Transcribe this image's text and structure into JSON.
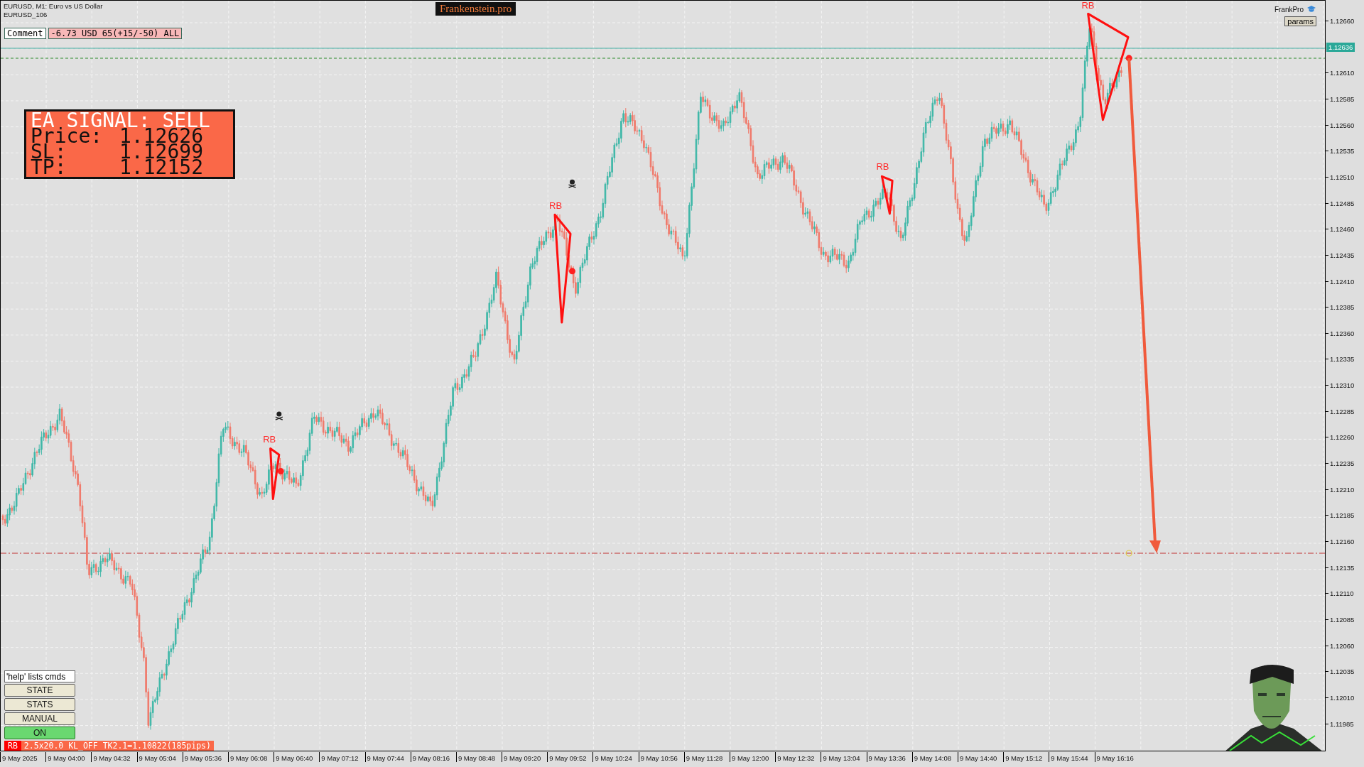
{
  "header": {
    "symbol_line": "EURUSD, M1:  Euro vs US Dollar",
    "subtitle": "EURUSD_106",
    "brand": "Frankenstein.pro",
    "account": "FrankPro",
    "params_button": "params"
  },
  "comment": {
    "label": "Comment",
    "value": "-6.73 USD 65(+15/-50) ALL"
  },
  "signal": {
    "title": "EA SIGNAL: SELL",
    "rows": [
      {
        "label": "Price:",
        "value": "1.12626"
      },
      {
        "label": "SL:",
        "value": "1.12699"
      },
      {
        "label": "TP:",
        "value": "1.12152"
      }
    ]
  },
  "patterns": [
    {
      "label": "RB"
    },
    {
      "label": "RB"
    },
    {
      "label": "RB"
    },
    {
      "label": "RB"
    }
  ],
  "controls": {
    "command_field": {
      "value": "'help' lists cmds"
    },
    "buttons": [
      {
        "label": "STATE",
        "on": false
      },
      {
        "label": "STATS",
        "on": false
      },
      {
        "label": "MANUAL",
        "on": false
      },
      {
        "label": "ON",
        "on": true
      }
    ]
  },
  "status_line": {
    "tag": "RB",
    "text": "2.5x20.0 KL_OFF TK2.1=1.10822(185pips)"
  },
  "price_axis": {
    "current_price": "1.12636",
    "ticks": [
      "1.12660",
      "1.12610",
      "1.12585",
      "1.12560",
      "1.12535",
      "1.12510",
      "1.12485",
      "1.12460",
      "1.12435",
      "1.12410",
      "1.12385",
      "1.12360",
      "1.12335",
      "1.12310",
      "1.12285",
      "1.12260",
      "1.12235",
      "1.12210",
      "1.12185",
      "1.12160",
      "1.12135",
      "1.12110",
      "1.12085",
      "1.12060",
      "1.12035",
      "1.12010",
      "1.11985"
    ]
  },
  "time_axis": [
    "9 May 2025",
    "9 May 04:00",
    "9 May 04:32",
    "9 May 05:04",
    "9 May 05:36",
    "9 May 06:08",
    "9 May 06:40",
    "9 May 07:12",
    "9 May 07:44",
    "9 May 08:16",
    "9 May 08:48",
    "9 May 09:20",
    "9 May 09:52",
    "9 May 10:24",
    "9 May 10:56",
    "9 May 11:28",
    "9 May 12:00",
    "9 May 12:32",
    "9 May 13:04",
    "9 May 13:36",
    "9 May 14:08",
    "9 May 14:40",
    "9 May 15:12",
    "9 May 15:44",
    "9 May 16:16"
  ]
}
